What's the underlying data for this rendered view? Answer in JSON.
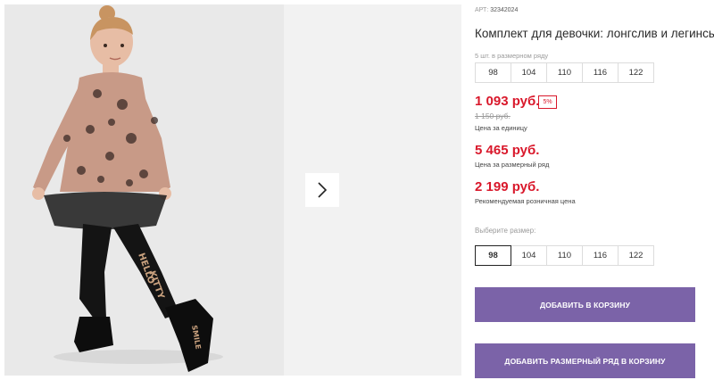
{
  "product": {
    "sku_label": "АРТ:",
    "sku_value": "32342024",
    "title": "Комплект для девочки: лонгслив и легинсы",
    "series_note": "5 шт. в размерном ряду"
  },
  "series_sizes": [
    "98",
    "104",
    "110",
    "116",
    "122"
  ],
  "pricing": {
    "unit_price": "1 093 руб.",
    "discount_badge": "5%",
    "old_price": "1 150 руб.",
    "unit_caption": "Цена за единицу",
    "series_price": "5 465 руб.",
    "series_caption": "Цена за размерный ряд",
    "retail_price": "2 199 руб.",
    "retail_caption": "Рекомендуемая розничная цена"
  },
  "size_select": {
    "label": "Выберите размер:",
    "options": [
      "98",
      "104",
      "110",
      "116",
      "122"
    ],
    "selected": "98"
  },
  "buttons": {
    "add_to_cart": "ДОБАВИТЬ В КОРЗИНУ",
    "add_series": "ДОБАВИТЬ РАЗМЕРНЫЙ РЯД В КОРЗИНУ"
  },
  "gallery": {
    "next_icon": "chevron-right-icon",
    "colors": {
      "background": "#e9e9e9",
      "top_print": "#c89a87",
      "black": "#141414",
      "skin": "#e7bda5",
      "hair": "#c89461"
    }
  },
  "colors": {
    "price_red": "#d9182b",
    "button_purple": "#7b63a8"
  }
}
